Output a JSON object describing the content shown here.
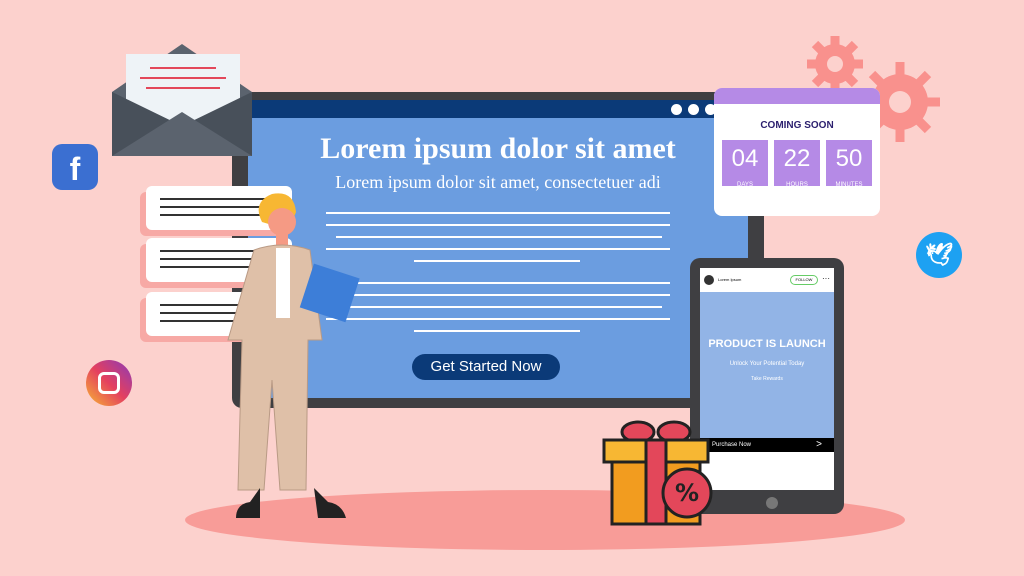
{
  "hero": {
    "title": "Lorem ipsum dolor sit amet",
    "subtitle": "Lorem ipsum dolor sit amet, consectetuer adi",
    "cta": "Get Started Now"
  },
  "countdown": {
    "heading": "COMING SOON",
    "days": "04",
    "days_label": "DAYS",
    "hours": "22",
    "hours_label": "HOURS",
    "minutes": "50",
    "minutes_label": "MINUTES"
  },
  "post": {
    "username": "Lorem Ipsum",
    "follow": "FOLLOW",
    "more": "···",
    "headline": "PRODUCT IS LAUNCH",
    "tagline": "Unlock Your Potential Today",
    "rewards": "Take Rewards",
    "purchase": "Purchase Now",
    "arrow": ">"
  },
  "colors": {
    "background": "#fcd1cd",
    "screen": "#6b9de0",
    "navy": "#0b3a78",
    "purple": "#b58ae6"
  },
  "icons": [
    "envelope-icon",
    "facebook-icon",
    "instagram-icon",
    "twitter-icon",
    "gear-icon",
    "gift-icon",
    "discount-badge-icon"
  ]
}
